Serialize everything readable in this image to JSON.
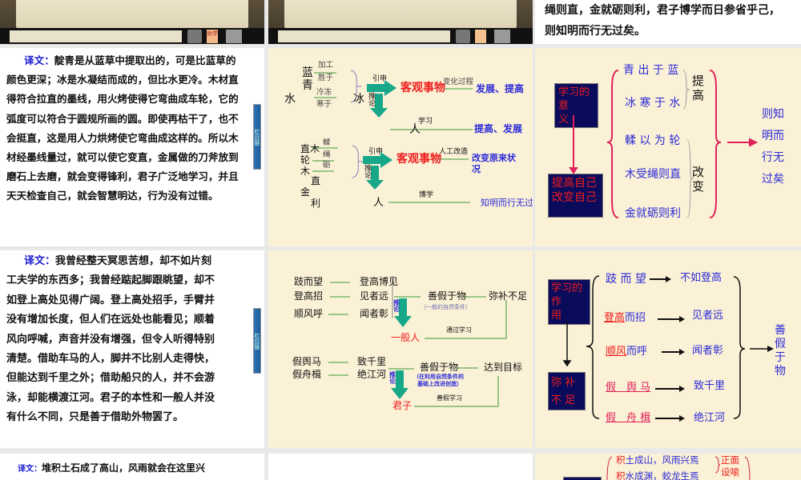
{
  "slides": {
    "top_right": {
      "lines": [
        "绳则直，金就砺则利，君子博学而日参省乎己，",
        "则知明而行无过矣。"
      ]
    },
    "top_nav": {
      "label": "劝学"
    },
    "trans1": {
      "label": "译文：",
      "lines": [
        "靛青是从蓝草中提取出的，可是比蓝草的",
        "颜色更深；冰是水凝结而成的，但比水更冷。木材直",
        "得符合拉直的墨线，用火烤使得它弯曲成车轮，它的",
        "弧度可以符合于圆规所画的圆。即使再枯干了，也不",
        "会挺直，这是用人力烘烤使它弯曲成这样的。所以木",
        "材经墨线量过，就可以使它变直，金属做的刀斧放到",
        "磨石上去磨，就会变得锋利，君子广泛地学习，并且",
        "天天检查自己，就会智慧明达，行为没有过错。"
      ],
      "side_button": "栏目链"
    },
    "trans2": {
      "label": "译文：",
      "lines": [
        "我曾经整天冥思苦想，却不如片刻",
        "工夫学的东西多；我曾经踮起脚跟眺望，却不",
        "如登上高处见得广阔。登上高处招手，手臂并",
        "没有增加长度，但人们在远处也能看见；顺着",
        "风向呼喊，声音并没有增强，但令人听得特别",
        "清楚。借助车马的人，脚并不比别人走得快，",
        "但能达到千里之外；借助船只的人，并不会游",
        "泳，却能横渡江河。君子的本性和一般人并没",
        "有什么不同，只是善于借助外物罢了。"
      ],
      "side_button": "栏目链"
    },
    "trans3": {
      "label": "译文：",
      "line": "堆积土石成了高山，风雨就会在这里兴"
    },
    "diagram1": {
      "water": "水",
      "lan": "蓝",
      "qing": "青",
      "jiagong": "加工",
      "shengyu": "胜于",
      "lengdong": "冷冻",
      "hanyu": "寒于",
      "bing": "冰",
      "yinshen": "引申",
      "tuilun": "推论",
      "keguan": "客观事物",
      "bianhua": "变化过程",
      "fazhan": "发展、提高",
      "ren": "人",
      "xuexi": "学习",
      "tigao": "提高、发展",
      "zhimu": "直木",
      "lun": "轮",
      "mu": "木",
      "zhi": "直",
      "jin": "金",
      "li": "利",
      "rou": "輮",
      "sheng": "绳",
      "li2": "砺",
      "rengong": "人工改造",
      "gaibian": "改变原来状",
      "kuang": "况",
      "boxue": "博学",
      "zhiming": "知明而行无过"
    },
    "diagram2": {
      "a1": "跂而望",
      "a2": "登高招",
      "a3": "顺风呼",
      "b1": "登高博见",
      "b2": "见者远",
      "b3": "闻者彰",
      "shanjia": "善假于物",
      "natural": "（一般的自然条件）",
      "mibu": "弥补不足",
      "tuilun": "推论",
      "yiban": "一般人",
      "tongguo": "通过学习",
      "c1": "假舆马",
      "c2": "假舟楫",
      "d1": "致千里",
      "d2": "绝江河",
      "shanjia2": "善假于物",
      "note1": "（在利用自然条件的",
      "note2": "基础上改进创造）",
      "mubiao": "达到目标",
      "junzi": "君子",
      "shanjiaxuexi": "善假学习"
    },
    "diagram3": {
      "box1": [
        "学习的",
        "意",
        "义"
      ],
      "box2": [
        "提高自己",
        "改变自己"
      ],
      "items": [
        "青 出 于 蓝",
        "冰 寒 于 水",
        "輮 以 为 轮",
        "木受绳则直",
        "金就砺则利"
      ],
      "tigao": [
        "提",
        "高"
      ],
      "gaibian": [
        "改",
        "变"
      ],
      "result": [
        "则知",
        "明而",
        "行无",
        "过矣"
      ]
    },
    "diagram4": {
      "box1": [
        "学习的",
        "作",
        "用"
      ],
      "box2": [
        "弥 补",
        "不 足"
      ],
      "items": [
        [
          "",
          "跂 而 望"
        ],
        [
          "登高",
          "而招"
        ],
        [
          "顺风",
          "而呼"
        ],
        [
          "假　舆 马",
          ""
        ],
        [
          "假　舟 楫",
          ""
        ]
      ],
      "results": [
        "不如登高",
        "见者远",
        "闻者彰",
        "致千里",
        "绝江河"
      ],
      "result": [
        "善",
        "假",
        "于",
        "物"
      ]
    },
    "diagram5": {
      "line1_red": "积",
      "line1": "土成山，风雨兴焉",
      "line2_red": "积",
      "line2": "水成渊，蛟龙生焉",
      "tag": [
        "正面",
        "设喻"
      ]
    }
  },
  "colors": {
    "cream": "#fbf1d6",
    "navy": "#0b0b5c",
    "red": "#ee1c1c",
    "blue": "#2a2ad8",
    "teal": "#17a88a"
  }
}
